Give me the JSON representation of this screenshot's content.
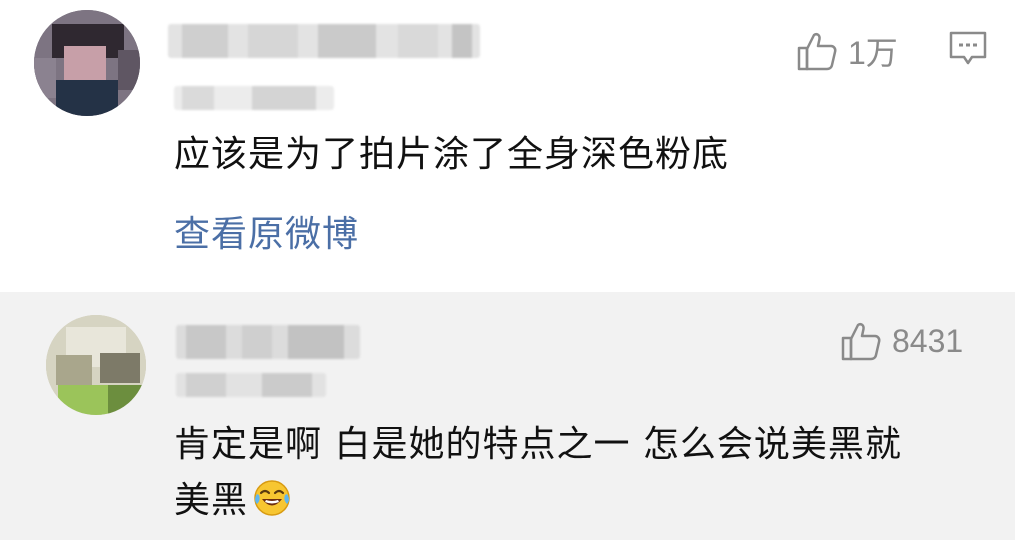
{
  "comments": [
    {
      "like_count": "1万",
      "text": "应该是为了拍片涂了全身深色粉底",
      "view_original_label": "查看原微博"
    },
    {
      "like_count": "8431",
      "text_line1": "肯定是啊 白是她的特点之一 怎么会说美黑就",
      "text_line2": "美黑"
    }
  ],
  "icons": {
    "like": "thumbs-up-outline-icon",
    "reply": "comment-bubble-icon",
    "emoji": "tears-of-joy-emoji-icon"
  },
  "colors": {
    "link": "#4b6fa6",
    "meta_gray": "#8a8a8a",
    "text": "#111111",
    "alt_row_bg": "#f2f2f2"
  }
}
